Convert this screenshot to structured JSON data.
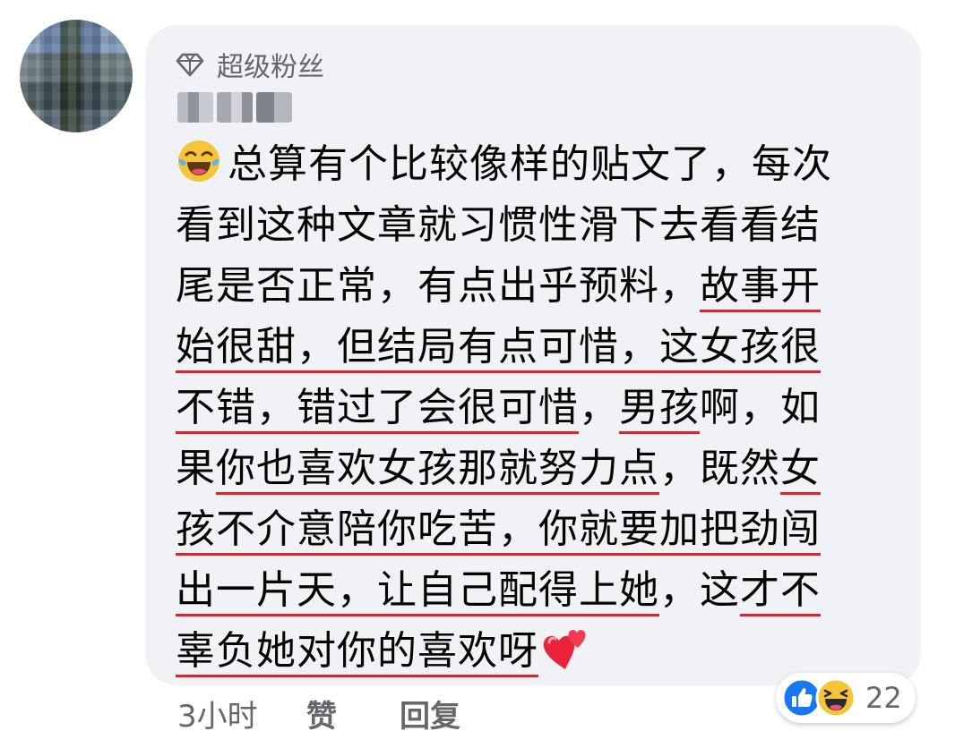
{
  "comment": {
    "badge_label": "超级粉丝",
    "lines": [
      [
        {
          "t": "总算有个比较像样的贴文了，每次",
          "u": false
        }
      ],
      [
        {
          "t": "看到这种文章就习惯性滑下去看看结",
          "u": false
        }
      ],
      [
        {
          "t": "尾是否正常，有点出乎预料，",
          "u": false
        },
        {
          "t": "故事开",
          "u": true
        }
      ],
      [
        {
          "t": "始很甜，但结局有点可惜，这女孩很",
          "u": true
        }
      ],
      [
        {
          "t": "不错，错过了会很可惜",
          "u": true
        },
        {
          "t": "，",
          "u": false
        },
        {
          "t": "男孩",
          "u": true
        },
        {
          "t": "啊，如",
          "u": false
        }
      ],
      [
        {
          "t": "果",
          "u": false
        },
        {
          "t": "你也喜欢女孩那就努力点",
          "u": true
        },
        {
          "t": "，既然",
          "u": false
        },
        {
          "t": "女",
          "u": true
        }
      ],
      [
        {
          "t": "孩不介意陪你吃苦，你就要加把劲闯",
          "u": true
        }
      ],
      [
        {
          "t": "出一片天，让自己配得上她",
          "u": true
        },
        {
          "t": "，这",
          "u": false
        },
        {
          "t": "才不",
          "u": true
        }
      ],
      [
        {
          "t": "辜负她对你的喜欢呀",
          "u": true
        }
      ]
    ],
    "emoji_start": "laughing-tears-emoji",
    "emoji_end": "two-hearts-emoji"
  },
  "meta": {
    "time": "3小时",
    "like_label": "赞",
    "reply_label": "回复"
  },
  "reactions": {
    "icons": [
      "like-reaction-icon",
      "haha-reaction-icon"
    ],
    "count": "22"
  },
  "colors": {
    "bubble": "#f0f2f5",
    "underline": "#e0222a",
    "secondary_text": "#65676b",
    "like_blue": "#1877f2"
  }
}
